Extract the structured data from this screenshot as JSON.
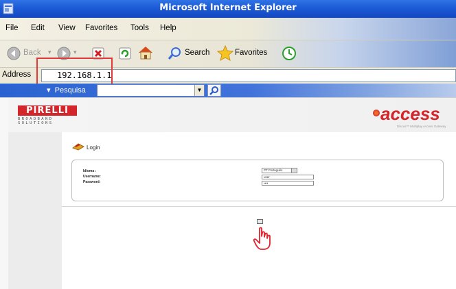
{
  "window": {
    "title": "Microsoft Internet Explorer"
  },
  "menu": {
    "items": [
      "File",
      "Edit",
      "View",
      "Favorites",
      "Tools",
      "Help"
    ]
  },
  "toolbar": {
    "back_label": "Back",
    "search_label": "Search",
    "favorites_label": "Favorites"
  },
  "address": {
    "label": "Address",
    "value": "192.168.1.1"
  },
  "links_bar": {
    "pesquisa_label": "Pesquisa"
  },
  "page": {
    "login_title": "Login",
    "fields": {
      "idioma_label": "Idioma :",
      "idioma_value": "PT Português",
      "username_label": "Username:",
      "username_value": "user",
      "password_label": "Password:",
      "password_value": "••••"
    }
  },
  "colors": {
    "accent_red": "#d4252a",
    "titlebar_blue": "#1c5ad6",
    "highlight_red": "#e03a3a"
  }
}
